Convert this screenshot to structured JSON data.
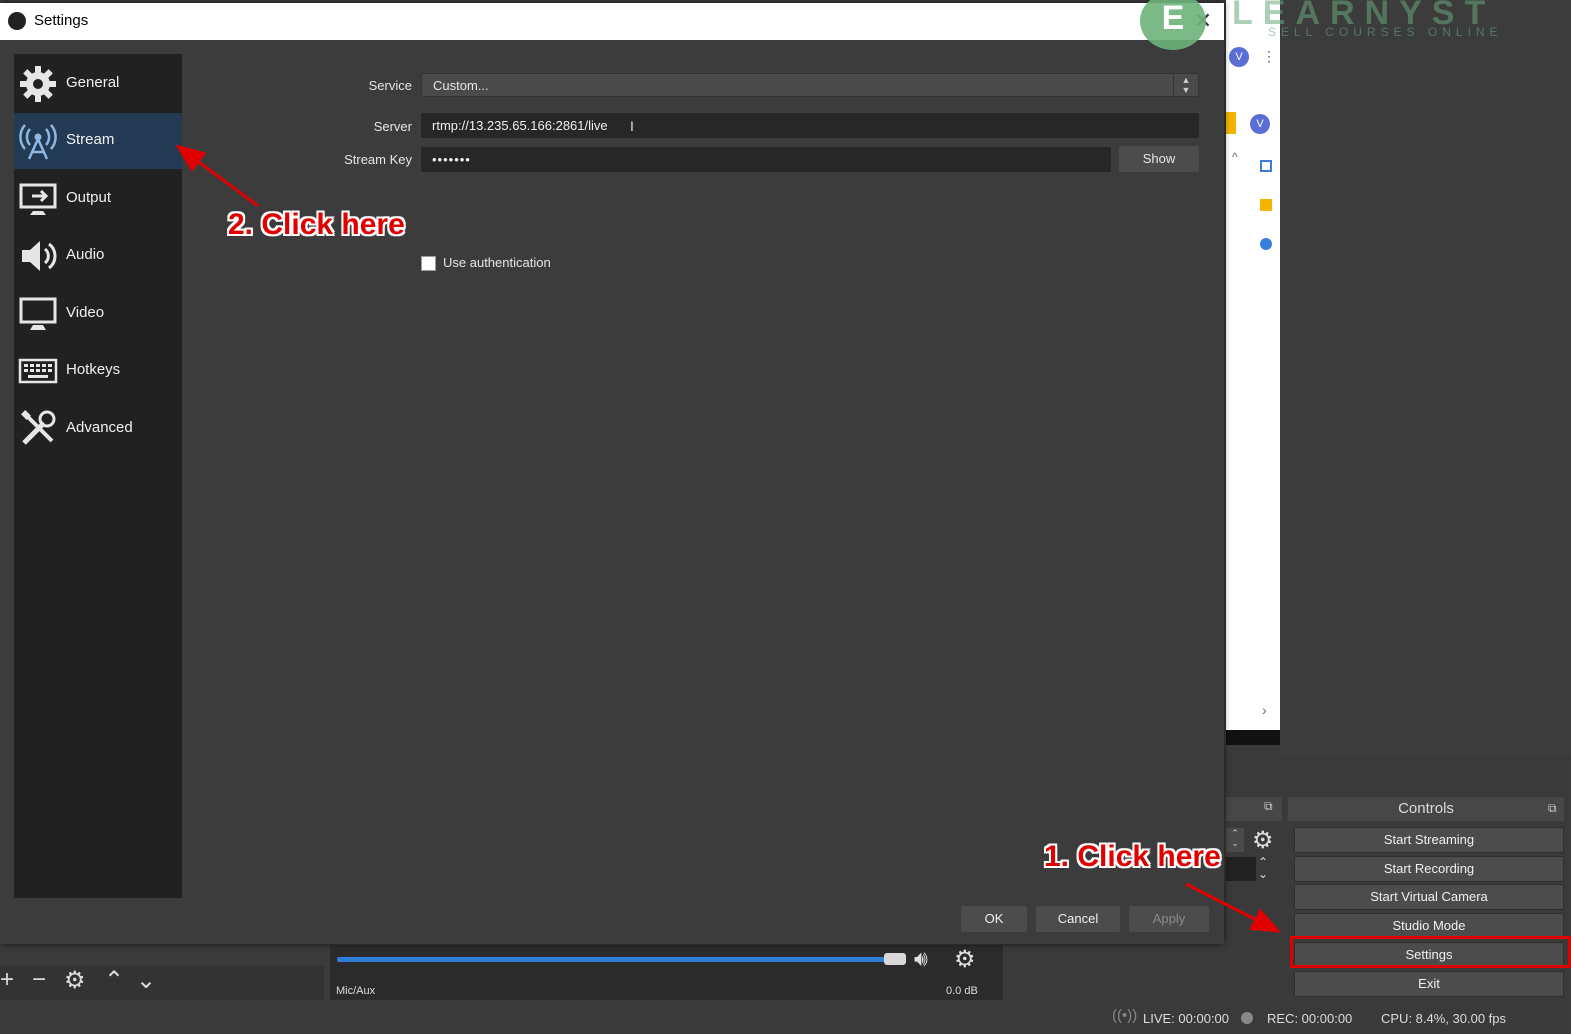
{
  "dialog": {
    "title": "Settings",
    "close_icon": "close-icon"
  },
  "watermark": {
    "brand": "LEARNYST",
    "tagline": "SELL COURSES ONLINE",
    "logo_letter": "E"
  },
  "browser": {
    "avatar_letter": "V"
  },
  "sidebar": {
    "items": [
      {
        "label": "General",
        "icon": "gear-icon"
      },
      {
        "label": "Stream",
        "icon": "antenna-icon"
      },
      {
        "label": "Output",
        "icon": "output-monitor-icon"
      },
      {
        "label": "Audio",
        "icon": "speaker-icon"
      },
      {
        "label": "Video",
        "icon": "monitor-icon"
      },
      {
        "label": "Hotkeys",
        "icon": "keyboard-icon"
      },
      {
        "label": "Advanced",
        "icon": "tools-icon"
      }
    ],
    "active": "Stream"
  },
  "stream": {
    "service_label": "Service",
    "service_value": "Custom...",
    "server_label": "Server",
    "server_value": "rtmp://13.235.65.166:2861/live",
    "key_label": "Stream Key",
    "key_value": "•••••••",
    "show_label": "Show",
    "auth_label": "Use authentication",
    "auth_checked": false
  },
  "buttons": {
    "ok": "OK",
    "cancel": "Cancel",
    "apply": "Apply"
  },
  "controls": {
    "title": "Controls",
    "items": [
      "Start Streaming",
      "Start Recording",
      "Start Virtual Camera",
      "Studio Mode",
      "Settings",
      "Exit"
    ]
  },
  "mixer": {
    "channel": "Mic/Aux",
    "level": "0.0 dB",
    "volume_fraction": 0.97
  },
  "status": {
    "live": "LIVE: 00:00:00",
    "rec": "REC: 00:00:00",
    "cpu": "CPU: 8.4%, 30.00 fps"
  },
  "annotations": {
    "step1": "1. Click here",
    "step2": "2. Click here",
    "color": "#e00000"
  }
}
